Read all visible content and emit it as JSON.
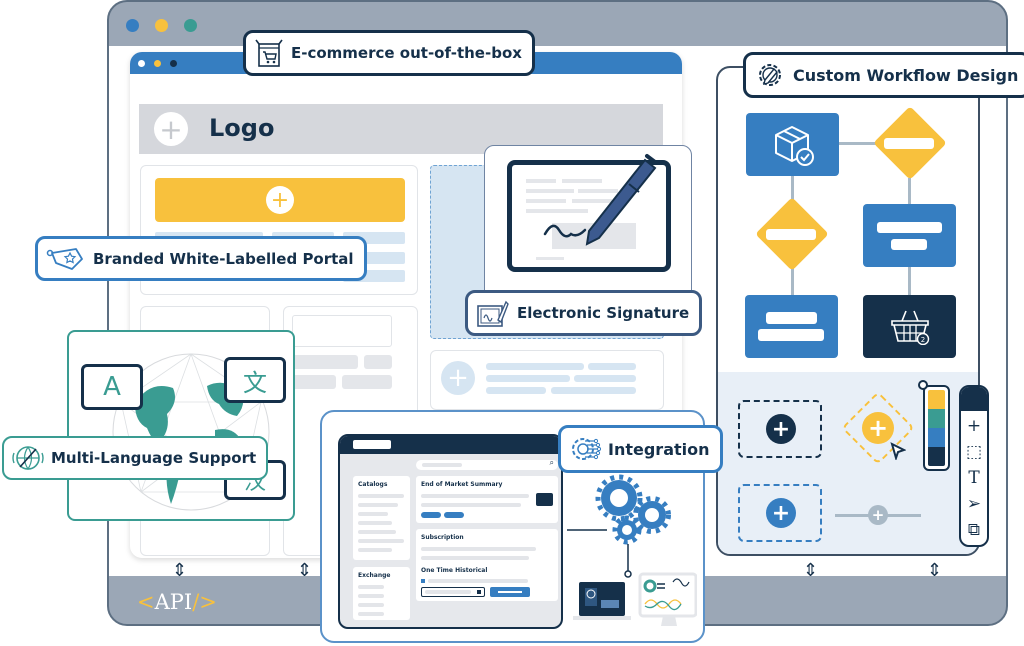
{
  "colors": {
    "navy": "#15304a",
    "blue": "#367ec1",
    "yellow": "#f8c13d",
    "teal": "#3a9c92",
    "grey_frame": "#9ba7b6",
    "light_blue": "#d6e5f2"
  },
  "outer_window": {
    "traffic_lights": [
      "#367ec1",
      "#f8c13d",
      "#3a9c92"
    ]
  },
  "storefront": {
    "logo_text": "Logo",
    "logo_icon": "plus-icon",
    "cta_icon": "plus-icon"
  },
  "badges": {
    "ecommerce": {
      "label": "E-commerce out-of-the-box",
      "icon": "shopping-cart-box-icon"
    },
    "workflow": {
      "label": "Custom Workflow Design",
      "icon": "gear-pencil-icon"
    },
    "branded": {
      "label": "Branded White-Labelled Portal",
      "icon": "price-tag-star-icon"
    },
    "signature": {
      "label": "Electronic Signature",
      "icon": "signature-pen-icon"
    },
    "language": {
      "label": "Multi-Language Support",
      "icon": "globe-chat-icon"
    },
    "integration": {
      "label": "Integration",
      "icon": "circuit-gear-icon"
    }
  },
  "language_bubbles": [
    "A",
    "文",
    "汉"
  ],
  "workflow": {
    "nodes": [
      {
        "type": "task",
        "icon": "package-check-icon"
      },
      {
        "type": "decision"
      },
      {
        "type": "decision"
      },
      {
        "type": "task"
      },
      {
        "type": "task"
      },
      {
        "type": "task",
        "icon": "basket-icon",
        "badge": "2"
      }
    ],
    "palette_colors": [
      "#f8c13d",
      "#3a9c92",
      "#367ec1",
      "#15304a"
    ],
    "tools": [
      "add-tool",
      "select-tool",
      "text-tool",
      "pointer-tool",
      "layers-tool"
    ],
    "tool_glyphs": [
      "+",
      "⬚",
      "T",
      "➢",
      "⧉"
    ]
  },
  "integration_app": {
    "sidebar_sections": [
      "Catalogs",
      "Exchange"
    ],
    "cards": [
      "End of Market Summary",
      "Subscription",
      "One Time Historical"
    ]
  },
  "api_label": {
    "open": "<",
    "text": "API",
    "close": "/>"
  }
}
